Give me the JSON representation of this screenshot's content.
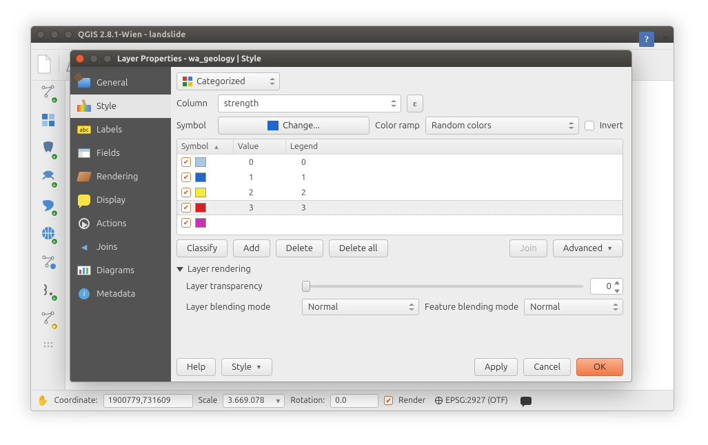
{
  "main_window": {
    "title": "QGIS 2.8.1-Wien - landslide"
  },
  "status_bar": {
    "coord_label": "Coordinate:",
    "coord_value": "1900779,731609",
    "scale_label": "Scale",
    "scale_value": "3.669.078",
    "rotation_label": "Rotation:",
    "rotation_value": "0.0",
    "render_label": "Render",
    "crs_label": "EPSG:2927 (OTF)"
  },
  "dialog": {
    "title": "Layer Properties - wa_geology | Style",
    "sidebar": [
      {
        "label": "General"
      },
      {
        "label": "Style"
      },
      {
        "label": "Labels",
        "icon_text": "abc"
      },
      {
        "label": "Fields"
      },
      {
        "label": "Rendering"
      },
      {
        "label": "Display"
      },
      {
        "label": "Actions"
      },
      {
        "label": "Joins"
      },
      {
        "label": "Diagrams"
      },
      {
        "label": "Metadata",
        "icon_text": "i"
      }
    ],
    "renderer_type": "Categorized",
    "column_label": "Column",
    "column_value": "strength",
    "expr_button": "ε",
    "symbol_label": "Symbol",
    "change_label": "Change...",
    "colorramp_label": "Color ramp",
    "colorramp_value": "Random colors",
    "invert_label": "Invert",
    "table": {
      "headers": {
        "symbol": "Symbol",
        "value": "Value",
        "legend": "Legend"
      },
      "rows": [
        {
          "color": "#a9c6e6",
          "value": "0",
          "legend": "0"
        },
        {
          "color": "#1f66d1",
          "value": "1",
          "legend": "1"
        },
        {
          "color": "#f4ea3a",
          "value": "2",
          "legend": "2"
        },
        {
          "color": "#d91f1f",
          "value": "3",
          "legend": "3",
          "selected": true
        },
        {
          "color": "#c433b6",
          "value": "",
          "legend": ""
        }
      ]
    },
    "buttons": {
      "classify": "Classify",
      "add": "Add",
      "delete": "Delete",
      "delete_all": "Delete all",
      "join": "Join",
      "advanced": "Advanced"
    },
    "layer_rendering": {
      "header": "Layer rendering",
      "transparency_label": "Layer transparency",
      "transparency_value": "0",
      "layer_blend_label": "Layer blending mode",
      "layer_blend_value": "Normal",
      "feature_blend_label": "Feature blending mode",
      "feature_blend_value": "Normal"
    },
    "footer": {
      "help": "Help",
      "style": "Style",
      "apply": "Apply",
      "cancel": "Cancel",
      "ok": "OK"
    }
  }
}
